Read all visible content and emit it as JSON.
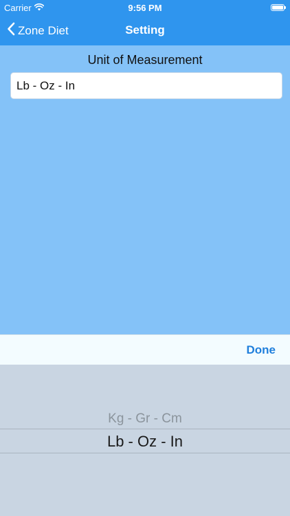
{
  "status_bar": {
    "carrier": "Carrier",
    "time": "9:56 PM"
  },
  "nav": {
    "back_label": "Zone Diet",
    "title": "Setting"
  },
  "main": {
    "section_label": "Unit of Measurement",
    "unit_value": "Lb - Oz - In"
  },
  "picker": {
    "done_label": "Done",
    "options": [
      "Kg - Gr - Cm",
      "Lb - Oz - In"
    ],
    "selected_index": 1
  },
  "colors": {
    "nav_background": "#2f95ee",
    "content_background": "#84c2f8",
    "accent": "#1f7fdc"
  }
}
